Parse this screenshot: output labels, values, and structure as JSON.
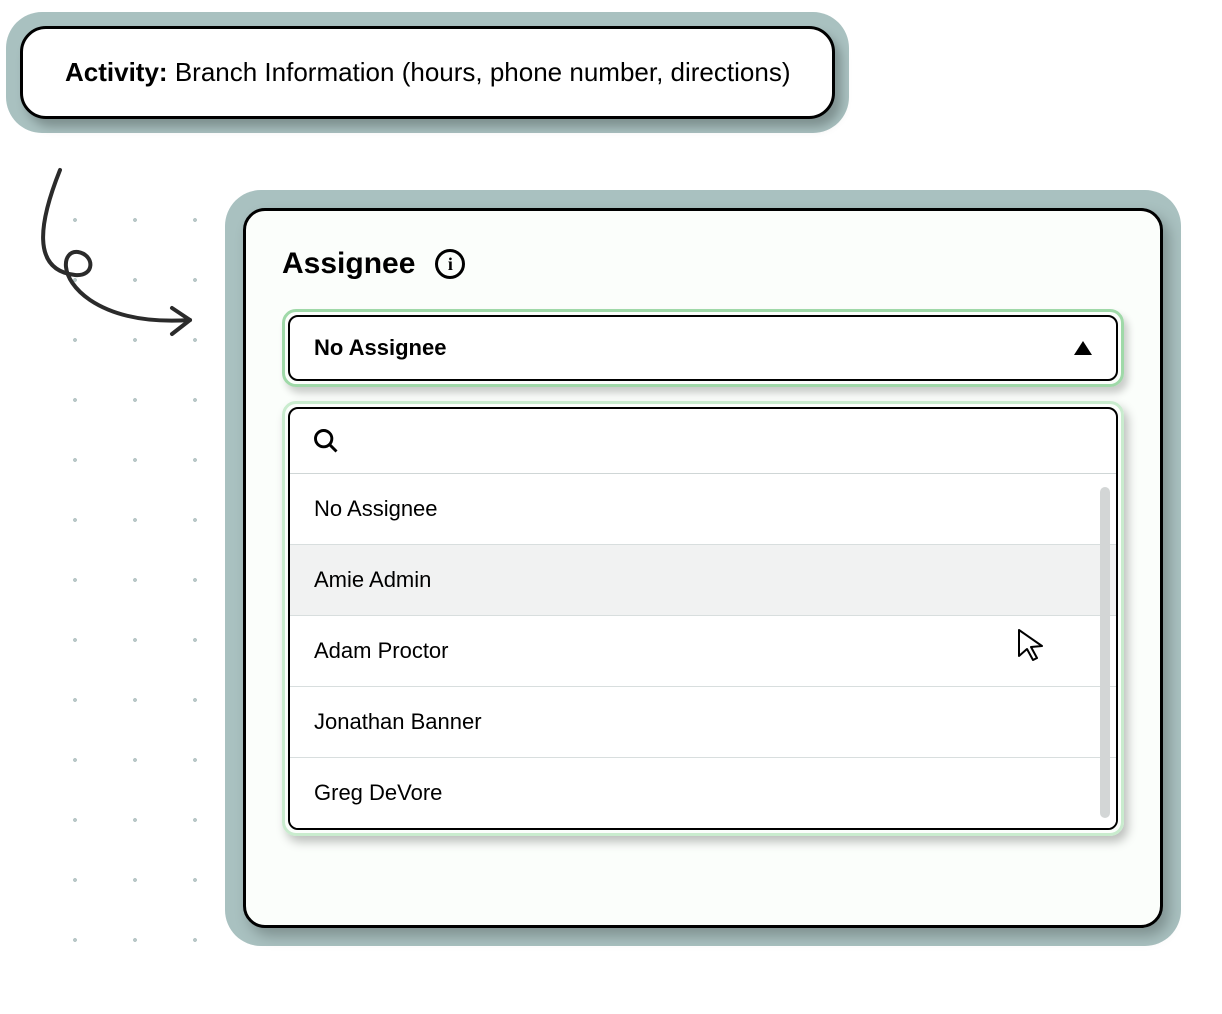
{
  "activity": {
    "label": "Activity:",
    "value": "Branch Information (hours, phone number, directions)"
  },
  "assignee": {
    "title": "Assignee",
    "info_icon": "i",
    "selected": "No Assignee",
    "search_placeholder": "",
    "options": [
      {
        "label": "No Assignee",
        "hover": false
      },
      {
        "label": "Amie Admin",
        "hover": true
      },
      {
        "label": "Adam Proctor",
        "hover": false
      },
      {
        "label": "Jonathan Banner",
        "hover": false
      },
      {
        "label": "Greg DeVore",
        "hover": false
      }
    ]
  }
}
